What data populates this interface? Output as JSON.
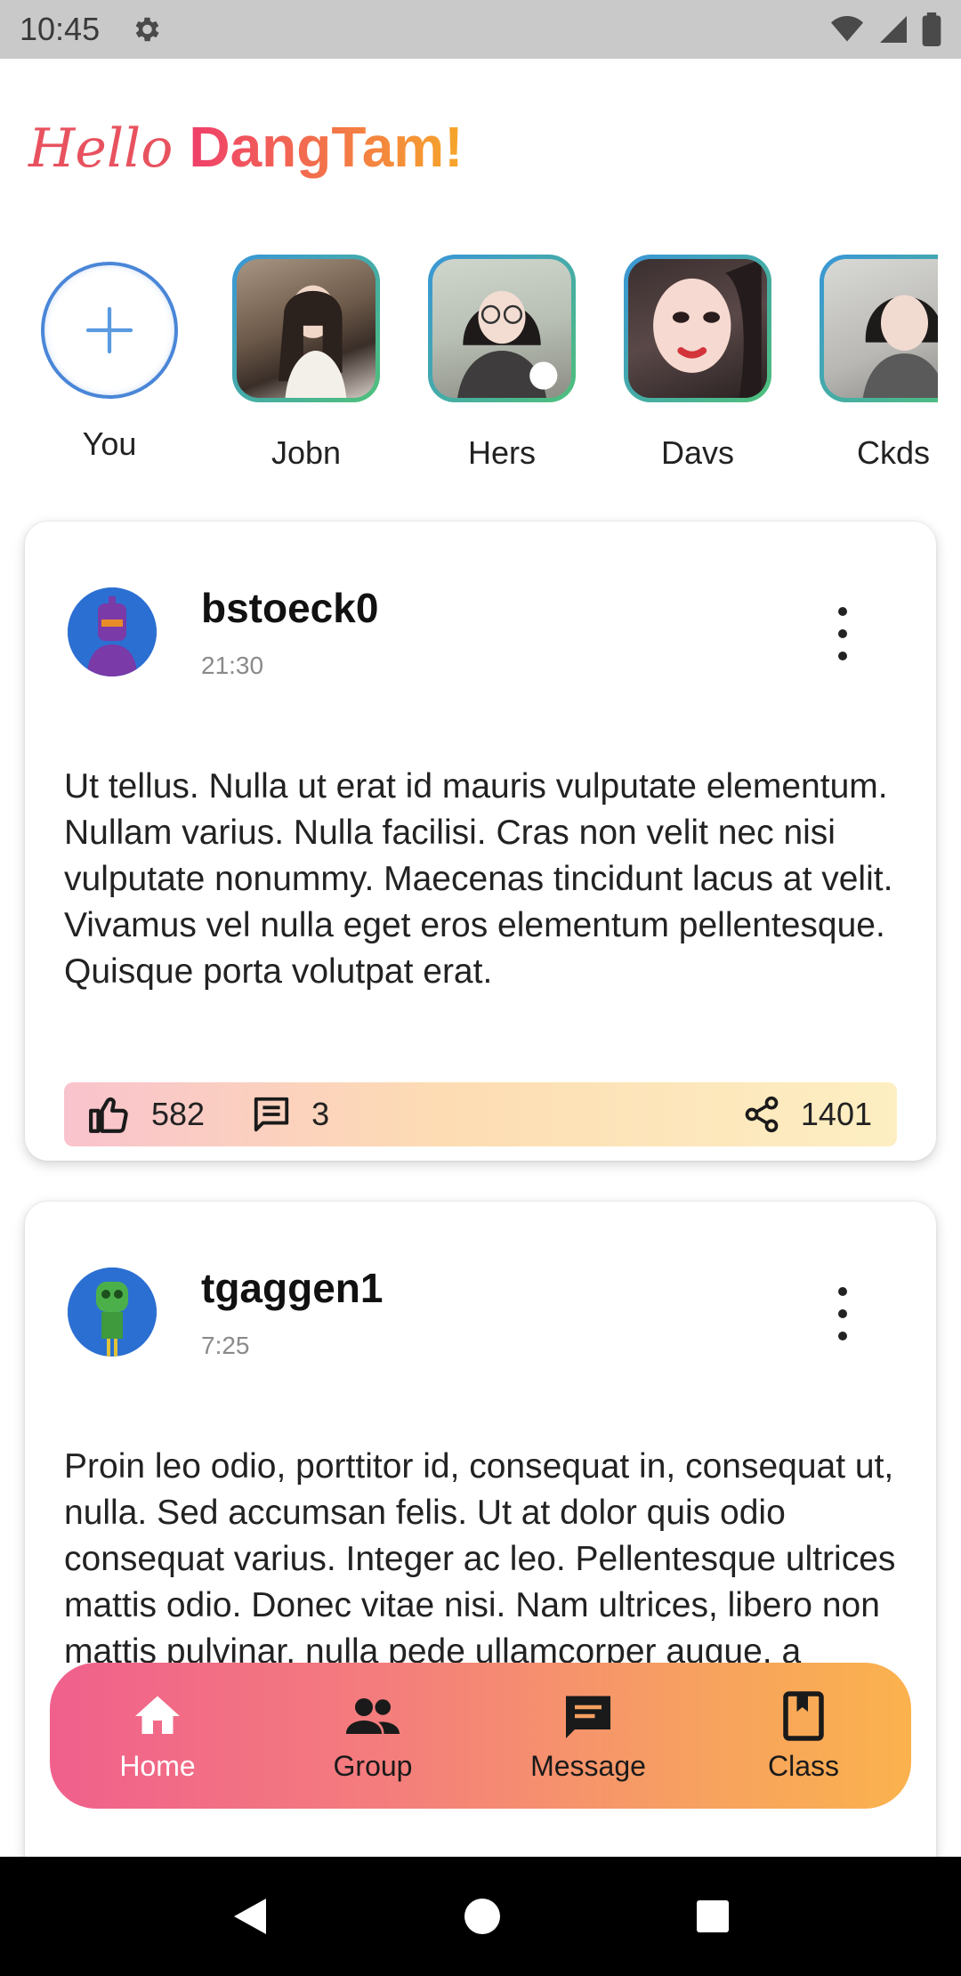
{
  "status_bar": {
    "time": "10:45"
  },
  "header": {
    "hello": "Hello",
    "name": "DangTam!"
  },
  "stories": [
    {
      "label": "You"
    },
    {
      "label": "Jobn"
    },
    {
      "label": "Hers"
    },
    {
      "label": "Davs"
    },
    {
      "label": "Ckds"
    }
  ],
  "posts": [
    {
      "user": "bstoeck0",
      "time": "21:30",
      "body": "Ut tellus. Nulla ut erat id mauris vulputate elementum. Nullam varius. Nulla facilisi. Cras non velit nec nisi vulputate nonummy. Maecenas tincidunt lacus at velit. Vivamus vel nulla eget eros elementum pellentesque. Quisque porta volutpat erat.",
      "likes": "582",
      "comments": "3",
      "shares": "1401"
    },
    {
      "user": "tgaggen1",
      "time": "7:25",
      "body": "Proin leo odio, porttitor id, consequat in, consequat ut, nulla. Sed accumsan felis. Ut at dolor quis odio consequat varius. Integer ac leo. Pellentesque ultrices mattis odio. Donec vitae nisi. Nam ultrices, libero non mattis pulvinar, nulla pede ullamcorper augue, a suscipit nulla elit at ipsum ac tellus semper interdum."
    }
  ],
  "bottom_nav": {
    "home": "Home",
    "group": "Group",
    "message": "Message",
    "class": "Class"
  },
  "colors": {
    "accent_pink": "#f0608c",
    "accent_orange": "#fbb24d",
    "story_ring": "#4a86d8"
  }
}
